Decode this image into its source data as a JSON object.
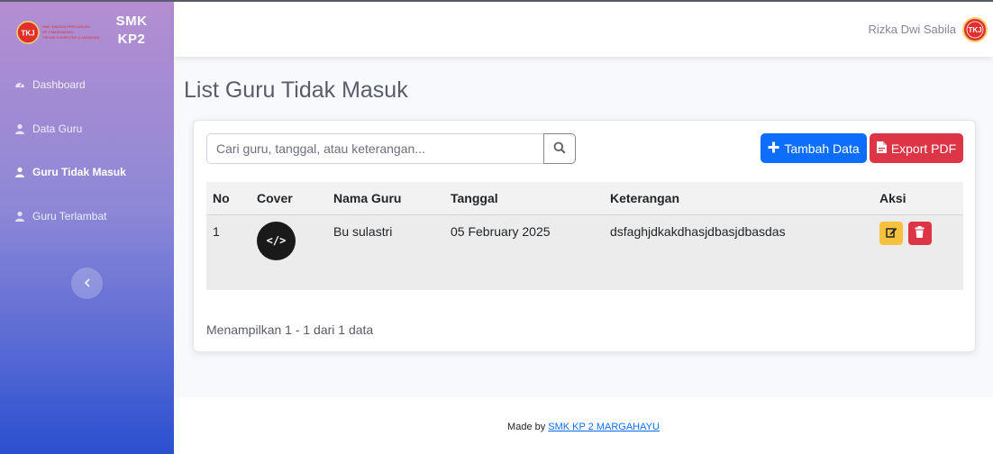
{
  "brand": {
    "name": "SMK KP2",
    "logo_text": "TKJ",
    "logo_lines": [
      "SMK SWASTA PERGURUAN",
      "KP 2 MARGAHAYU",
      "TEKNIK KOMPUTER & JARINGAN"
    ]
  },
  "sidebar": {
    "items": [
      {
        "label": "Dashboard",
        "icon": "tachometer-icon"
      },
      {
        "label": "Data Guru",
        "icon": "user-icon"
      },
      {
        "label": "Guru Tidak Masuk",
        "icon": "user-icon",
        "active": true
      },
      {
        "label": "Guru Terlambat",
        "icon": "user-icon"
      }
    ],
    "toggle_icon": "chevron-left-icon"
  },
  "topbar": {
    "user_name": "Rizka Dwi Sabila"
  },
  "page": {
    "title": "List Guru Tidak Masuk"
  },
  "search": {
    "placeholder": "Cari guru, tanggal, atau keterangan...",
    "value": ""
  },
  "actions": {
    "add_label": "Tambah Data",
    "export_label": "Export PDF"
  },
  "table": {
    "headers": [
      "No",
      "Cover",
      "Nama Guru",
      "Tanggal",
      "Keterangan",
      "Aksi"
    ],
    "rows": [
      {
        "no": "1",
        "cover": "</>",
        "nama": "Bu sulastri",
        "tanggal": "05 February 2025",
        "keterangan": "dsfaghjdkakdhasjdbasjdbasdas"
      }
    ]
  },
  "pagination": {
    "showing": "Menampilkan 1 - 1 dari 1 data"
  },
  "footer": {
    "prefix": "Made by",
    "link": "SMK KP 2 MARGAHAYU"
  },
  "colors": {
    "primary": "#0d6efd",
    "danger": "#dc3545",
    "warning": "#f6c23e",
    "sidebar_top": "#b48ed1",
    "sidebar_bottom": "#2a4fd0"
  }
}
